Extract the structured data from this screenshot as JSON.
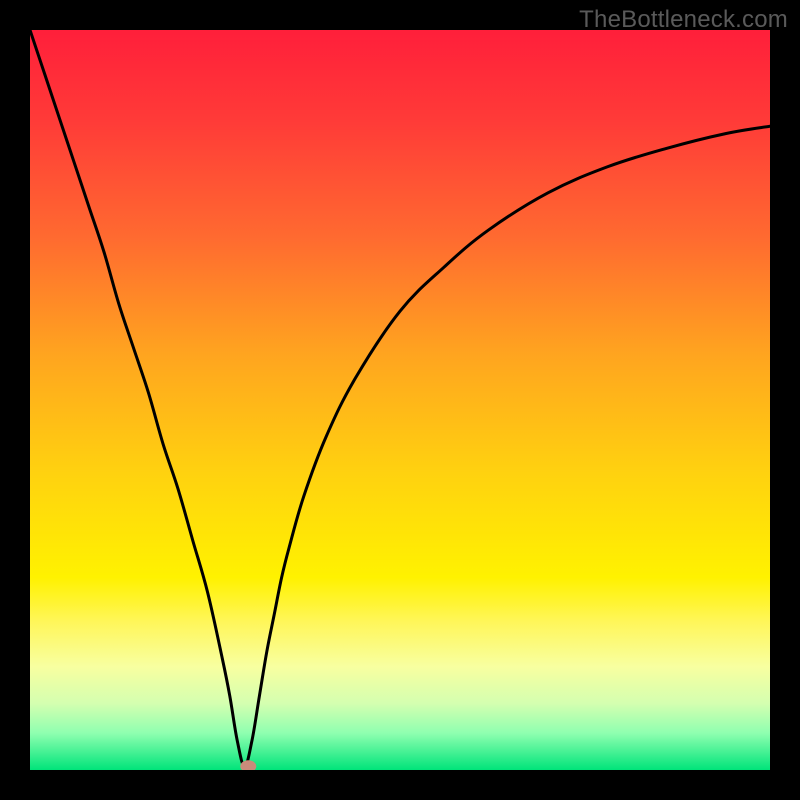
{
  "watermark": "TheBottleneck.com",
  "chart_data": {
    "type": "line",
    "title": "",
    "xlabel": "",
    "ylabel": "",
    "xlim": [
      0,
      100
    ],
    "ylim": [
      0,
      100
    ],
    "grid": false,
    "legend": false,
    "series": [
      {
        "name": "bottleneck-curve",
        "x": [
          0,
          2,
          4,
          6,
          8,
          10,
          12,
          14,
          16,
          18,
          20,
          22,
          24,
          26,
          27,
          28,
          29,
          30,
          31,
          32,
          33,
          34,
          35,
          37,
          40,
          44,
          50,
          56,
          62,
          70,
          78,
          86,
          94,
          100
        ],
        "values": [
          100,
          94,
          88,
          82,
          76,
          70,
          63,
          57,
          51,
          44,
          38,
          31,
          24,
          15,
          10,
          4,
          0.5,
          4,
          10,
          16,
          21,
          26,
          30,
          37,
          45,
          53,
          62,
          68,
          73,
          78,
          81.5,
          84,
          86,
          87
        ]
      }
    ],
    "background_gradient": {
      "stops": [
        {
          "offset": 0.0,
          "color": "#ff1f3a"
        },
        {
          "offset": 0.12,
          "color": "#ff3a38"
        },
        {
          "offset": 0.28,
          "color": "#ff6a30"
        },
        {
          "offset": 0.44,
          "color": "#ffa51f"
        },
        {
          "offset": 0.6,
          "color": "#ffd20f"
        },
        {
          "offset": 0.74,
          "color": "#fff200"
        },
        {
          "offset": 0.8,
          "color": "#fff65a"
        },
        {
          "offset": 0.86,
          "color": "#f8ffa0"
        },
        {
          "offset": 0.91,
          "color": "#d4ffb0"
        },
        {
          "offset": 0.95,
          "color": "#8fffb0"
        },
        {
          "offset": 1.0,
          "color": "#00e47a"
        }
      ]
    },
    "marker": {
      "series": "bottleneck-curve",
      "x": 29.5,
      "y": 0.5,
      "color": "#c98b7a",
      "rx": 8,
      "ry": 6
    }
  }
}
